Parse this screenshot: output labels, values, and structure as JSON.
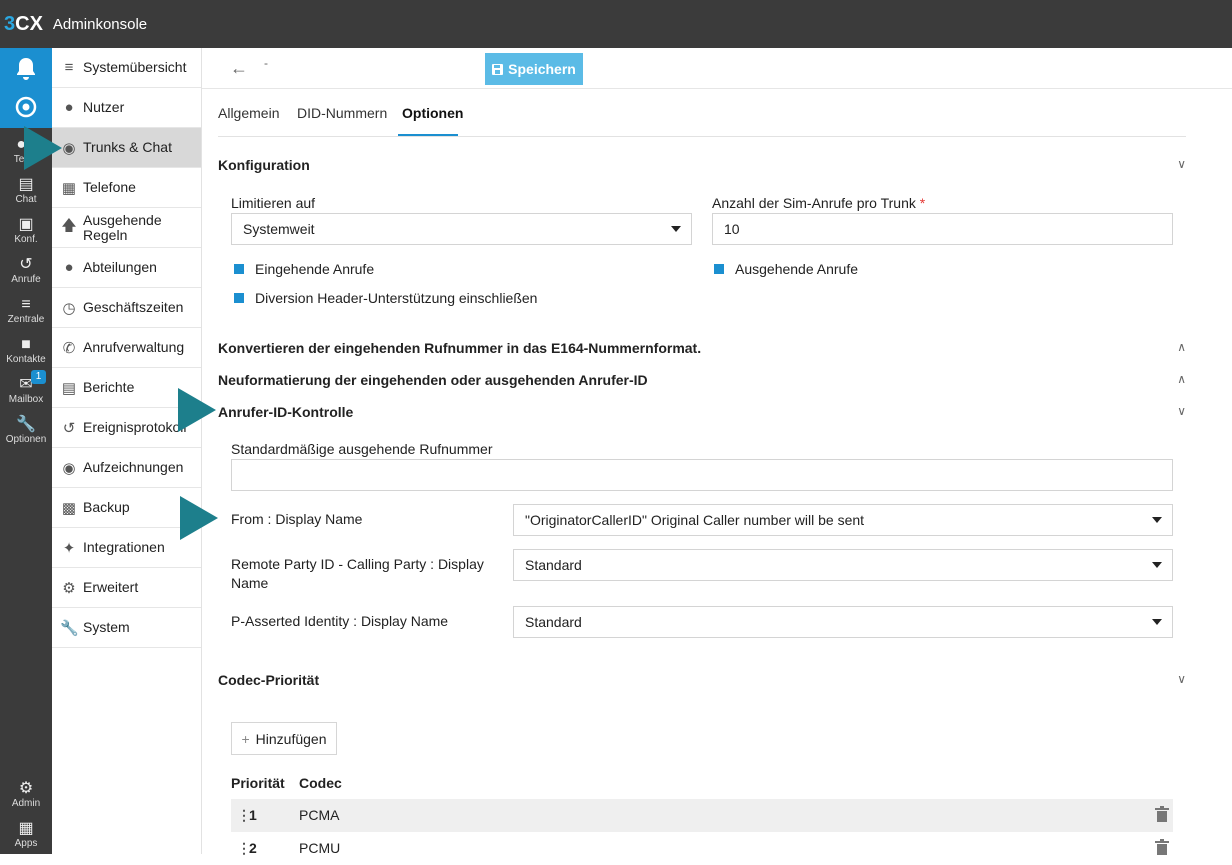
{
  "app": {
    "logo_num": "3",
    "logo_cx": "CX",
    "title": "Adminkonsole"
  },
  "rail": {
    "items": [
      {
        "label": "Team",
        "icon": "team-icon"
      },
      {
        "label": "Chat",
        "icon": "chat-icon"
      },
      {
        "label": "Konf.",
        "icon": "conference-icon"
      },
      {
        "label": "Anrufe",
        "icon": "history-icon"
      },
      {
        "label": "Zentrale",
        "icon": "switchboard-icon"
      },
      {
        "label": "Kontakte",
        "icon": "contacts-icon"
      },
      {
        "label": "Mailbox",
        "icon": "mailbox-icon",
        "badge": "1"
      },
      {
        "label": "Optionen",
        "icon": "wrench-icon"
      }
    ],
    "bottom": [
      {
        "label": "Admin",
        "icon": "gear-icon"
      },
      {
        "label": "Apps",
        "icon": "apps-icon"
      }
    ]
  },
  "menu": {
    "items": [
      {
        "label": "Systemübersicht"
      },
      {
        "label": "Nutzer"
      },
      {
        "label": "Trunks & Chat"
      },
      {
        "label": "Telefone"
      },
      {
        "label": "Ausgehende Regeln"
      },
      {
        "label": "Abteilungen"
      },
      {
        "label": "Geschäftszeiten"
      },
      {
        "label": "Anrufverwaltung"
      },
      {
        "label": "Berichte"
      },
      {
        "label": "Ereignisprotokoll"
      },
      {
        "label": "Aufzeichnungen"
      },
      {
        "label": "Backup"
      },
      {
        "label": "Integrationen"
      },
      {
        "label": "Erweitert"
      },
      {
        "label": "System"
      }
    ]
  },
  "toolbar": {
    "crumb": "-",
    "save_label": "Speichern"
  },
  "tabs": [
    "Allgemein",
    "DID-Nummern",
    "Optionen"
  ],
  "config": {
    "title": "Konfiguration",
    "limit_label": "Limitieren auf",
    "limit_value": "Systemweit",
    "sim_label": "Anzahl der Sim-Anrufe pro Trunk",
    "sim_required": "*",
    "sim_value": "10",
    "cb_incoming": "Eingehende Anrufe",
    "cb_outgoing": "Ausgehende Anrufe",
    "cb_diversion": "Diversion Header-Unterstützung einschließen"
  },
  "sections": {
    "e164": "Konvertieren der eingehenden Rufnummer in das E164-Nummernformat.",
    "reformat": "Neuformatierung der eingehenden oder ausgehenden Anrufer-ID",
    "callerid": "Anrufer-ID-Kontrolle",
    "codec": "Codec-Priorität"
  },
  "callerid": {
    "default_label": "Standardmäßige ausgehende Rufnummer",
    "default_value": "",
    "from_label": "From : Display Name",
    "from_value": "\"OriginatorCallerID\" Original Caller number will be sent",
    "rpid_label": "Remote Party ID - Calling Party : Display Name",
    "rpid_value": "Standard",
    "pai_label": "P-Asserted Identity : Display Name",
    "pai_value": "Standard"
  },
  "codec": {
    "add_label": "Hinzufügen",
    "col_priority": "Priorität",
    "col_codec": "Codec",
    "rows": [
      {
        "priority": "1",
        "codec": "PCMA"
      },
      {
        "priority": "2",
        "codec": "PCMU"
      }
    ]
  },
  "colors": {
    "accent": "#1b8fd0",
    "save": "#5bbbe6",
    "arrow": "#1d7f8c",
    "topbar": "#3b3b3b"
  }
}
